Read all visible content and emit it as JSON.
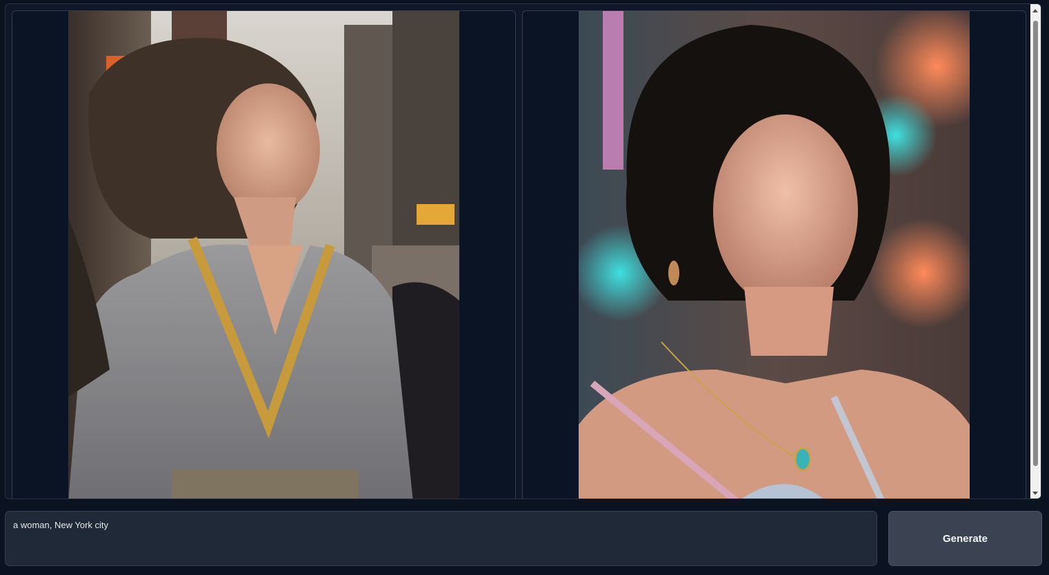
{
  "gallery": {
    "images": [
      {
        "label": "woman-grey-dress-city-street",
        "icon": "generated-image"
      },
      {
        "label": "woman-dark-hair-neon-street",
        "icon": "generated-image"
      }
    ]
  },
  "prompt": {
    "value": "a woman, New York city"
  },
  "generate_button": {
    "label": "Generate"
  },
  "colors": {
    "background": "#0b1220",
    "panel": "#1f2937",
    "button": "#3b4252"
  }
}
